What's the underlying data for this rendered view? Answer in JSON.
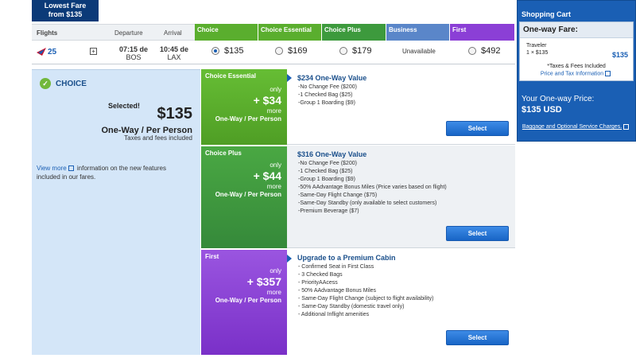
{
  "lowest_fare": {
    "line1": "Lowest Fare",
    "line2": "from $135"
  },
  "flight_table": {
    "headers": {
      "flights": "Flights",
      "departure": "Departure",
      "arrival": "Arrival"
    },
    "fare_columns": [
      {
        "label": "Choice",
        "color": "#5aae2e"
      },
      {
        "label": "Choice Essential",
        "color": "#5aae2e"
      },
      {
        "label": "Choice Plus",
        "color": "#3d9a3d"
      },
      {
        "label": "Business",
        "color": "#5a86c9"
      },
      {
        "label": "First",
        "color": "#8b3fd6"
      }
    ],
    "flight": {
      "number": "25",
      "dep_time": "07:15 de",
      "dep_airport": "BOS",
      "arr_time": "10:45 de",
      "arr_airport": "LAX",
      "prices": [
        "$135",
        "$169",
        "$179",
        "Unavailable",
        "$492"
      ]
    }
  },
  "choice": {
    "title": "CHOICE",
    "selected_label": "Selected!",
    "price": "$135",
    "oneway_label": "One-Way / Per Person",
    "taxes_label": "Taxes and fees included",
    "view_more_link": "View more",
    "view_more_text": "information on the new features included in our fares."
  },
  "offers": [
    {
      "name": "Choice Essential",
      "only": "only",
      "amount": "+ $34",
      "more": "more",
      "per": "One-Way / Per Person",
      "color": "#5aae2e",
      "title": "$234 One-Way Value",
      "items": [
        "-No Change Fee ($200)",
        "-1 Checked Bag ($25)",
        "-Group 1 Boarding ($9)"
      ],
      "button": "Select"
    },
    {
      "name": "Choice Plus",
      "only": "only",
      "amount": "+ $44",
      "more": "more",
      "per": "One-Way / Per Person",
      "color": "#3f9a3a",
      "title": "$316 One-Way Value",
      "items": [
        "-No Change Fee ($200)",
        "-1 Checked Bag ($25)",
        "-Group 1 Boarding ($9)",
        "-50% AAdvantage Bonus Miles (Price varies based on flight)",
        "-Same-Day Flight Change ($75)",
        "-Same-Day Standby (only available to select customers)",
        "-Premium Beverage ($7)"
      ],
      "button": "Select"
    },
    {
      "name": "First",
      "only": "only",
      "amount": "+ $357",
      "more": "more",
      "per": "One-Way / Per Person",
      "color": "#8b3fd6",
      "title": "Upgrade to a Premium Cabin",
      "items": [
        "- Confirmed Seat in First Class",
        "- 3 Checked Bags",
        "- PriorityAAcess",
        "- 50% AAdvantage Bonus Miles",
        "- Same-Day Flight Change (subject to flight availability)",
        "- Same-Day Standby (domestic travel only)",
        "- Additional Inflight amenities"
      ],
      "button": "Select"
    }
  ],
  "cart": {
    "title": "Shopping Cart",
    "fare_head": "One-way Fare:",
    "traveler": "Traveler",
    "traveler_price": "1 × $135",
    "total": "$135",
    "taxes": "*Taxes & Fees Included",
    "price_link": "Price and Tax Information",
    "oneway_label": "Your One-way Price:",
    "oneway_price": "$135 USD",
    "bag_link": "Baggage and Optional Service Charges."
  }
}
